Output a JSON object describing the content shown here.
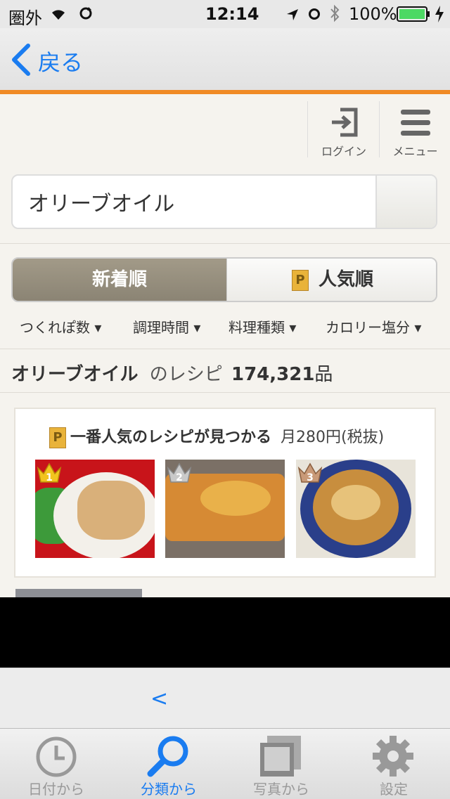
{
  "status_bar": {
    "carrier": "圏外",
    "time": "12:14",
    "battery": "100%",
    "icons": [
      "wifi-icon",
      "sync-icon",
      "location-icon",
      "alarm-icon",
      "bluetooth-icon",
      "battery-icon",
      "charging-icon"
    ]
  },
  "nav": {
    "back_label": "戻る",
    "accent_color": "#1a7cf0"
  },
  "header": {
    "login_label": "ログイン",
    "menu_label": "メニュー"
  },
  "search": {
    "value": "オリーブオイル"
  },
  "sort": {
    "new_label": "新着順",
    "popular_label": "人気順",
    "premium_glyph": "P"
  },
  "filters": [
    "つくれぽ数 ▾",
    "調理時間 ▾",
    "料理種類 ▾",
    "カロリー塩分 ▾"
  ],
  "results": {
    "keyword": "オリーブオイル",
    "middle": "のレシピ",
    "count": "174,321",
    "unit": "品"
  },
  "premium": {
    "headline": "一番人気のレシピが見つかる",
    "price": "月280円(税抜)",
    "ranks": [
      "1",
      "2",
      "3"
    ]
  },
  "browser": {
    "back_glyph": "<"
  },
  "tabs": [
    {
      "label": "日付から",
      "icon": "clock-icon",
      "active": false
    },
    {
      "label": "分類から",
      "icon": "search-icon",
      "active": true
    },
    {
      "label": "写真から",
      "icon": "photos-icon",
      "active": false
    },
    {
      "label": "設定",
      "icon": "gear-icon",
      "active": false
    }
  ],
  "colors": {
    "brand_orange": "#f08a24",
    "ios_blue": "#1a7cf0",
    "gold": "#e9b33a"
  }
}
